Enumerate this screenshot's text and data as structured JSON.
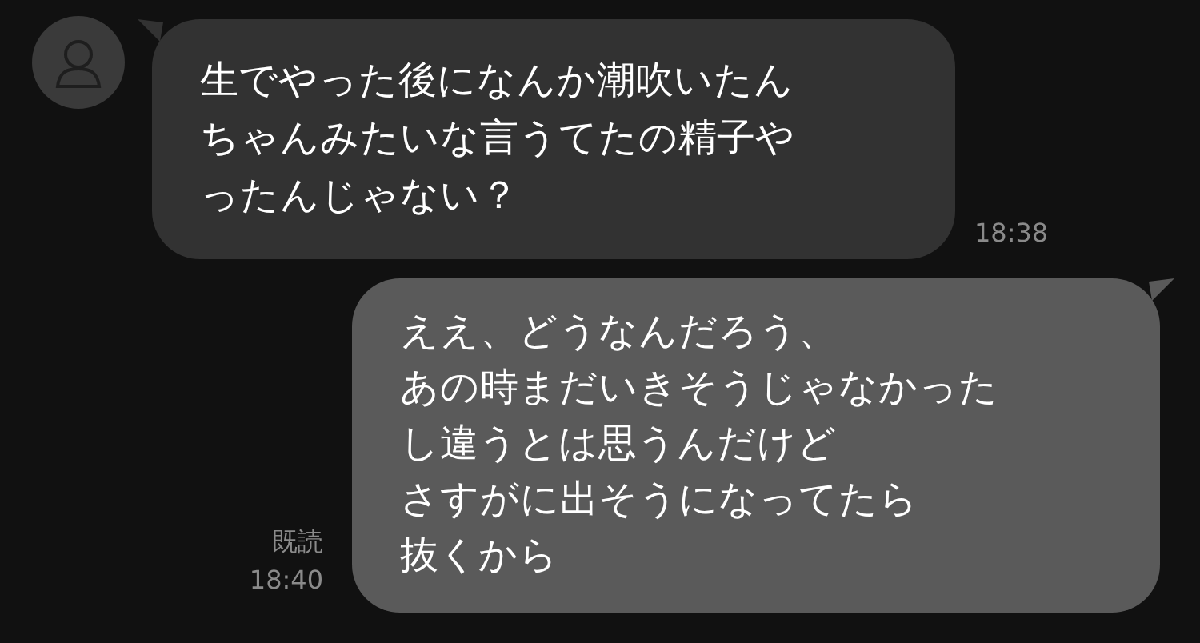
{
  "messages": [
    {
      "kind": "incoming",
      "paragraphs": [
        "生でやった後になんか潮吹いたんちゃんみたいな言うてたの精子やったんじゃない？"
      ],
      "time": "18:38"
    },
    {
      "kind": "outgoing",
      "paragraphs": [
        "ええ、どうなんだろう、",
        "あの時まだいきそうじゃなかったし違うとは思うんだけど",
        "さすがに出そうになってたら",
        "抜くから"
      ],
      "read": "既読",
      "time": "18:40"
    }
  ]
}
